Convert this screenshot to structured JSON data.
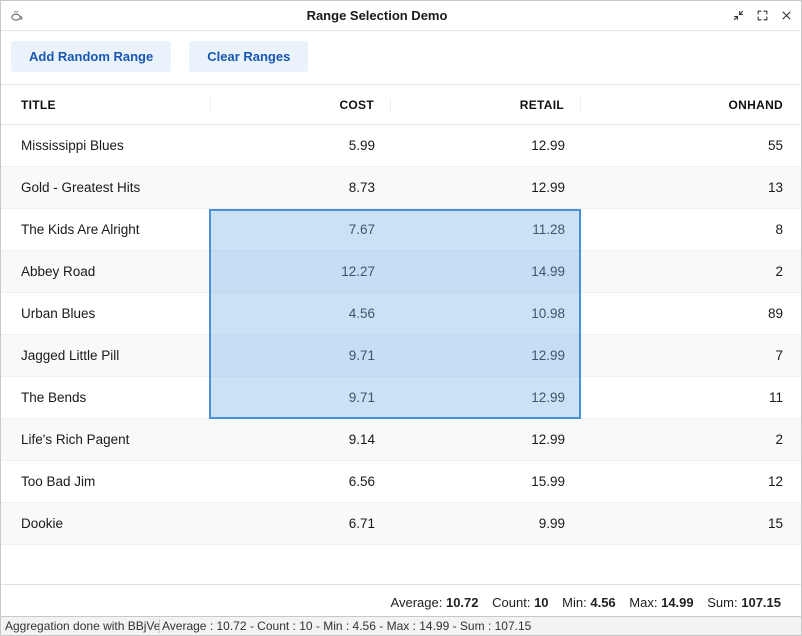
{
  "window": {
    "title": "Range Selection Demo"
  },
  "toolbar": {
    "add_random_range": "Add Random Range",
    "clear_ranges": "Clear Ranges"
  },
  "columns": {
    "title": "TITLE",
    "cost": "COST",
    "retail": "RETAIL",
    "onhand": "ONHAND"
  },
  "rows": [
    {
      "title": "Mississippi Blues",
      "cost": "5.99",
      "retail": "12.99",
      "onhand": "55"
    },
    {
      "title": "Gold - Greatest Hits",
      "cost": "8.73",
      "retail": "12.99",
      "onhand": "13"
    },
    {
      "title": "The Kids Are Alright",
      "cost": "7.67",
      "retail": "11.28",
      "onhand": "8"
    },
    {
      "title": "Abbey Road",
      "cost": "12.27",
      "retail": "14.99",
      "onhand": "2"
    },
    {
      "title": "Urban Blues",
      "cost": "4.56",
      "retail": "10.98",
      "onhand": "89"
    },
    {
      "title": "Jagged Little Pill",
      "cost": "9.71",
      "retail": "12.99",
      "onhand": "7"
    },
    {
      "title": "The Bends",
      "cost": "9.71",
      "retail": "12.99",
      "onhand": "11"
    },
    {
      "title": "Life's Rich Pagent",
      "cost": "9.14",
      "retail": "12.99",
      "onhand": "2"
    },
    {
      "title": "Too Bad Jim",
      "cost": "6.56",
      "retail": "15.99",
      "onhand": "12"
    },
    {
      "title": "Dookie",
      "cost": "6.71",
      "retail": "9.99",
      "onhand": "15"
    }
  ],
  "selection": {
    "row_start": 2,
    "row_end": 6,
    "col_start": 1,
    "col_end": 2
  },
  "aggregation": {
    "average_label": "Average:",
    "average": "10.72",
    "count_label": "Count:",
    "count": "10",
    "min_label": "Min:",
    "min": "4.56",
    "max_label": "Max:",
    "max": "14.99",
    "sum_label": "Sum:",
    "sum": "107.15"
  },
  "status": {
    "left": "Aggregation done with BBjVectors",
    "right": "Average : 10.72 - Count : 10 - Min : 4.56 - Max : 14.99 - Sum : 107.15"
  }
}
